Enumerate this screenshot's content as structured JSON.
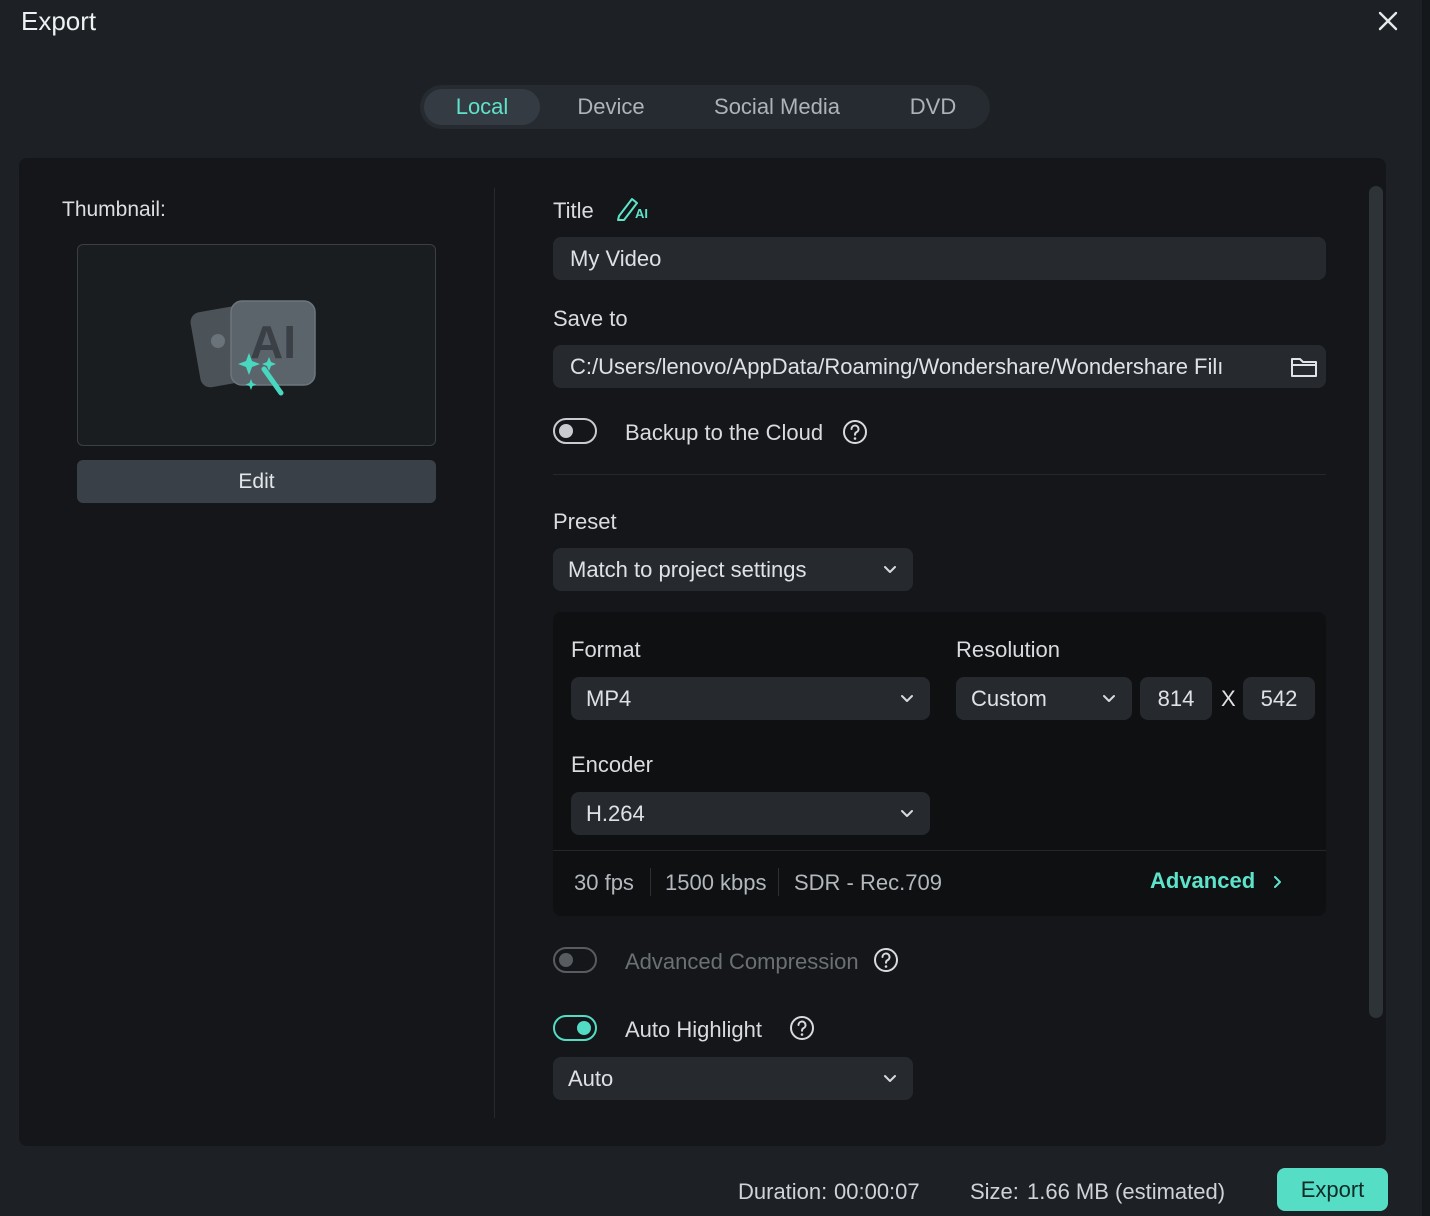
{
  "window": {
    "title": "Export"
  },
  "tabs": [
    {
      "label": "Local",
      "active": true
    },
    {
      "label": "Device",
      "active": false
    },
    {
      "label": "Social Media",
      "active": false
    },
    {
      "label": "DVD",
      "active": false
    }
  ],
  "thumbnail": {
    "label": "Thumbnail:",
    "badge_text": "AI",
    "edit_label": "Edit"
  },
  "title_field": {
    "label": "Title",
    "ai_icon_text": "AI",
    "value": "My Video"
  },
  "save_to": {
    "label": "Save to",
    "value": "C:/Users/lenovo/AppData/Roaming/Wondershare/Wondershare Filı"
  },
  "backup": {
    "label": "Backup to the Cloud",
    "enabled": false
  },
  "preset": {
    "label": "Preset",
    "value": "Match to project settings"
  },
  "format": {
    "label": "Format",
    "value": "MP4"
  },
  "resolution": {
    "label": "Resolution",
    "mode": "Custom",
    "width": "814",
    "separator": "X",
    "height": "542"
  },
  "encoder": {
    "label": "Encoder",
    "value": "H.264"
  },
  "specs": {
    "fps": "30 fps",
    "bitrate": "1500 kbps",
    "color": "SDR - Rec.709",
    "advanced_label": "Advanced"
  },
  "advanced_compression": {
    "label": "Advanced Compression",
    "enabled": false,
    "disabled": true
  },
  "auto_highlight": {
    "label": "Auto Highlight",
    "enabled": true,
    "mode": "Auto"
  },
  "footer": {
    "duration_label": "Duration:",
    "duration_value": "00:00:07",
    "size_label": "Size:",
    "size_value": "1.66 MB (estimated)",
    "export_label": "Export"
  },
  "colors": {
    "accent": "#56ddc6",
    "background": "#1d2125",
    "panel": "#141619",
    "field": "#262a2f"
  }
}
